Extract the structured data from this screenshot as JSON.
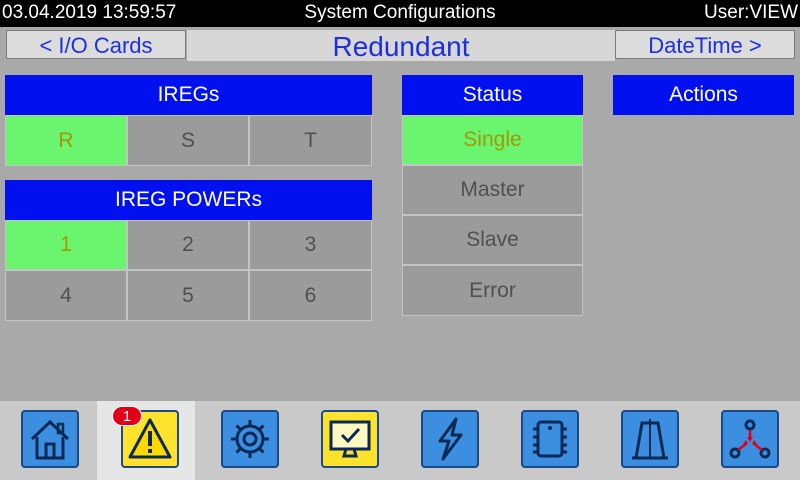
{
  "topbar": {
    "datetime": "03.04.2019 13:59:57",
    "title": "System Configurations",
    "user": "User:VIEW"
  },
  "nav": {
    "left_label": "< I/O Cards",
    "page_title": "Redundant",
    "right_label": "DateTime >"
  },
  "iregs": {
    "header": "IREGs",
    "cells": [
      {
        "label": "R",
        "active": true
      },
      {
        "label": "S",
        "active": false
      },
      {
        "label": "T",
        "active": false
      }
    ]
  },
  "ireg_powers": {
    "header": "IREG POWERs",
    "cells": [
      {
        "label": "1",
        "active": true
      },
      {
        "label": "2",
        "active": false
      },
      {
        "label": "3",
        "active": false
      },
      {
        "label": "4",
        "active": false
      },
      {
        "label": "5",
        "active": false
      },
      {
        "label": "6",
        "active": false
      }
    ]
  },
  "status": {
    "header": "Status",
    "items": [
      {
        "label": "Single",
        "active": true
      },
      {
        "label": "Master",
        "active": false
      },
      {
        "label": "Slave",
        "active": false
      },
      {
        "label": "Error",
        "active": false
      }
    ]
  },
  "actions": {
    "header": "Actions"
  },
  "dock": {
    "alarm_count": "1",
    "buttons": [
      {
        "icon": "home-icon"
      },
      {
        "icon": "warning-icon"
      },
      {
        "icon": "gear-icon"
      },
      {
        "icon": "monitor-check-icon"
      },
      {
        "icon": "lightning-icon"
      },
      {
        "icon": "chip-icon"
      },
      {
        "icon": "waveform-icon"
      },
      {
        "icon": "network-icon"
      }
    ]
  },
  "colors": {
    "active_green": "#6bf46d",
    "header_blue": "#0010ee",
    "accent_text": "#1d2fe0"
  }
}
